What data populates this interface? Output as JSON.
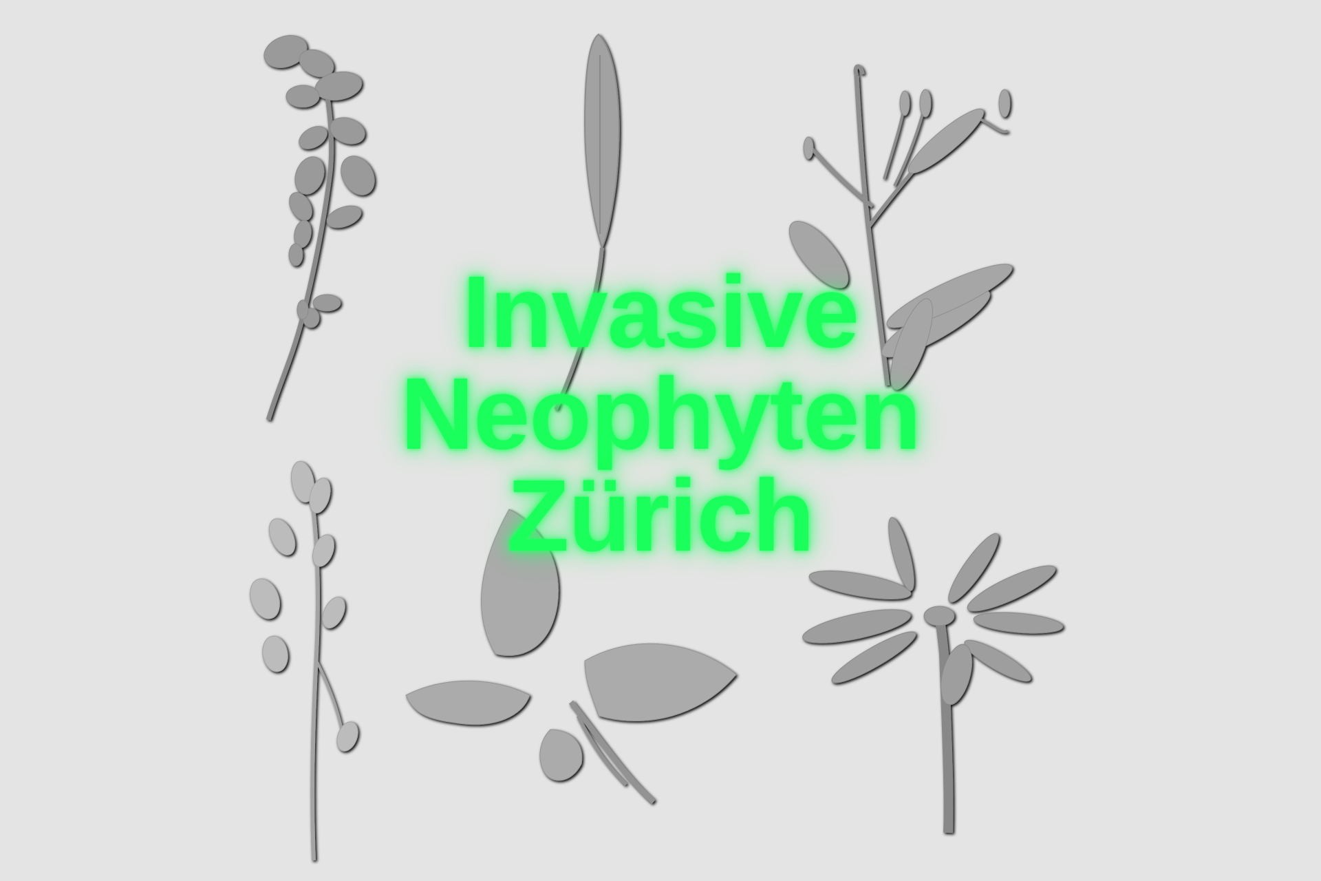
{
  "title": {
    "lines": [
      "Invasive",
      "Neophyten",
      "Zürich"
    ],
    "color": "#1aff5c"
  },
  "background": {
    "color": "#e4e4e4"
  },
  "illustrations": {
    "style": "grey embossed plant specimens",
    "items": [
      "branch-with-berries-icon",
      "lanceolate-leaf-icon",
      "leafy-shrub-sprig-icon",
      "flowering-stalk-icon",
      "broad-leaves-icon",
      "daisy-flower-icon"
    ]
  }
}
